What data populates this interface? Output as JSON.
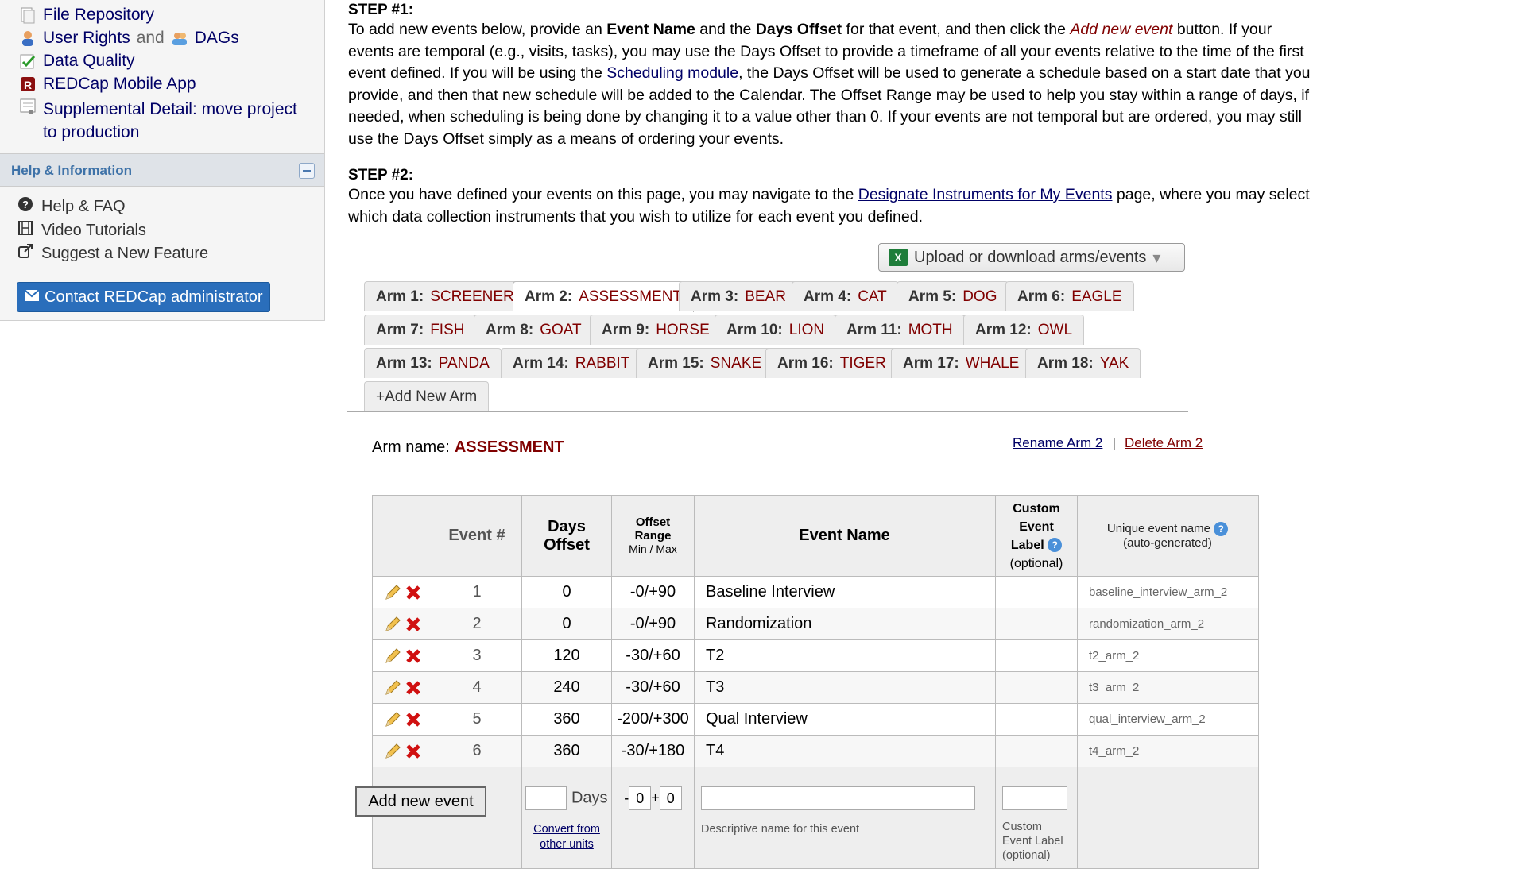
{
  "sidebar": {
    "links": [
      {
        "label": "File Repository",
        "icon": "file-repository-icon"
      },
      {
        "label": "User Rights",
        "and": "and",
        "label2": "DAGs",
        "icon": "user-icon",
        "icon2": "group-icon"
      },
      {
        "label": "Data Quality",
        "icon": "checklist-icon"
      },
      {
        "label": "REDCap Mobile App",
        "icon": "mobile-app-icon"
      },
      {
        "label": "Supplemental Detail: move project",
        "label2": "to production",
        "icon": "document-icon"
      }
    ],
    "help_title": "Help & Information",
    "help_links": [
      {
        "label": "Help & FAQ",
        "icon": "question-circle-icon"
      },
      {
        "label": "Video Tutorials",
        "icon": "film-icon"
      },
      {
        "label": "Suggest a New Feature",
        "icon": "external-link-icon"
      }
    ],
    "contact_label": "Contact REDCap administrator"
  },
  "step1": {
    "title": "STEP #1:",
    "t1": "To add new events below, provide an ",
    "b1": "Event Name",
    "t2": " and the ",
    "b2": "Days Offset",
    "t3": " for that event, and then click the ",
    "em": "Add new event",
    "t4": " button. If your events are temporal (e.g., visits, tasks), you may use the Days Offset to provide a timeframe of all your events relative to the time of the first event defined. If you will be using the ",
    "link": "Scheduling module",
    "t5": ", the Days Offset will be used to generate a schedule based on a start date that you provide, and then that new schedule will be added to the Calendar. The Offset Range may be used to help you stay within a range of days, if needed, when scheduling is being done by changing it to a value other than 0. If your events are not temporal but are ordered, you may still use the Days Offset simply as a means of ordering your events."
  },
  "step2": {
    "title": "STEP #2:",
    "t1": "Once you have defined your events on this page, you may navigate to the ",
    "link": "Designate Instruments for My Events",
    "t2": " page, where you may select which data collection instruments that you wish to utilize for each event you defined."
  },
  "upload_label": "Upload or download arms/events",
  "arms": [
    {
      "no": "Arm 1:",
      "name": "SCREENER"
    },
    {
      "no": "Arm 2:",
      "name": "ASSESSMENT"
    },
    {
      "no": "Arm 3:",
      "name": "BEAR"
    },
    {
      "no": "Arm 4:",
      "name": "CAT"
    },
    {
      "no": "Arm 5:",
      "name": "DOG"
    },
    {
      "no": "Arm 6:",
      "name": "EAGLE"
    },
    {
      "no": "Arm 7:",
      "name": "FISH"
    },
    {
      "no": "Arm 8:",
      "name": "GOAT"
    },
    {
      "no": "Arm 9:",
      "name": "HORSE"
    },
    {
      "no": "Arm 10:",
      "name": "LION"
    },
    {
      "no": "Arm 11:",
      "name": "MOTH"
    },
    {
      "no": "Arm 12:",
      "name": "OWL"
    },
    {
      "no": "Arm 13:",
      "name": "PANDA"
    },
    {
      "no": "Arm 14:",
      "name": "RABBIT"
    },
    {
      "no": "Arm 15:",
      "name": "SNAKE"
    },
    {
      "no": "Arm 16:",
      "name": "TIGER"
    },
    {
      "no": "Arm 17:",
      "name": "WHALE"
    },
    {
      "no": "Arm 18:",
      "name": "YAK"
    }
  ],
  "add_arm_label": "+Add New Arm",
  "arm_name_label": "Arm name:",
  "arm_name_value": "ASSESSMENT",
  "rename_label": "Rename Arm 2",
  "delete_label": "Delete Arm 2",
  "table": {
    "headers": {
      "event_num": "Event #",
      "days_offset": "Days Offset",
      "offset_range": "Offset Range",
      "min_max": "Min / Max",
      "event_name": "Event Name",
      "custom_label_1": "Custom Event",
      "custom_label_2": "Label",
      "custom_label_opt": "(optional)",
      "unique_1": "Unique event name",
      "unique_2": "(auto-generated)"
    },
    "rows": [
      {
        "num": "1",
        "days": "0",
        "range": "-0/+90",
        "name": "Baseline Interview",
        "unique": "baseline_interview_arm_2"
      },
      {
        "num": "2",
        "days": "0",
        "range": "-0/+90",
        "name": "Randomization",
        "unique": "randomization_arm_2"
      },
      {
        "num": "3",
        "days": "120",
        "range": "-30/+60",
        "name": "T2",
        "unique": "t2_arm_2"
      },
      {
        "num": "4",
        "days": "240",
        "range": "-30/+60",
        "name": "T3",
        "unique": "t3_arm_2"
      },
      {
        "num": "5",
        "days": "360",
        "range": "-200/+300",
        "name": "Qual Interview",
        "unique": "qual_interview_arm_2"
      },
      {
        "num": "6",
        "days": "360",
        "range": "-30/+180",
        "name": "T4",
        "unique": "t4_arm_2"
      }
    ],
    "add_event_label": "Add new event",
    "days_label": "Days",
    "convert_label_1": "Convert from",
    "convert_label_2": "other units",
    "range_min_value": "0",
    "range_max_value": "0",
    "event_name_hint": "Descriptive name for this event",
    "custom_hint_1": "Custom",
    "custom_hint_2": "Event Label",
    "custom_hint_3": "(optional)"
  }
}
